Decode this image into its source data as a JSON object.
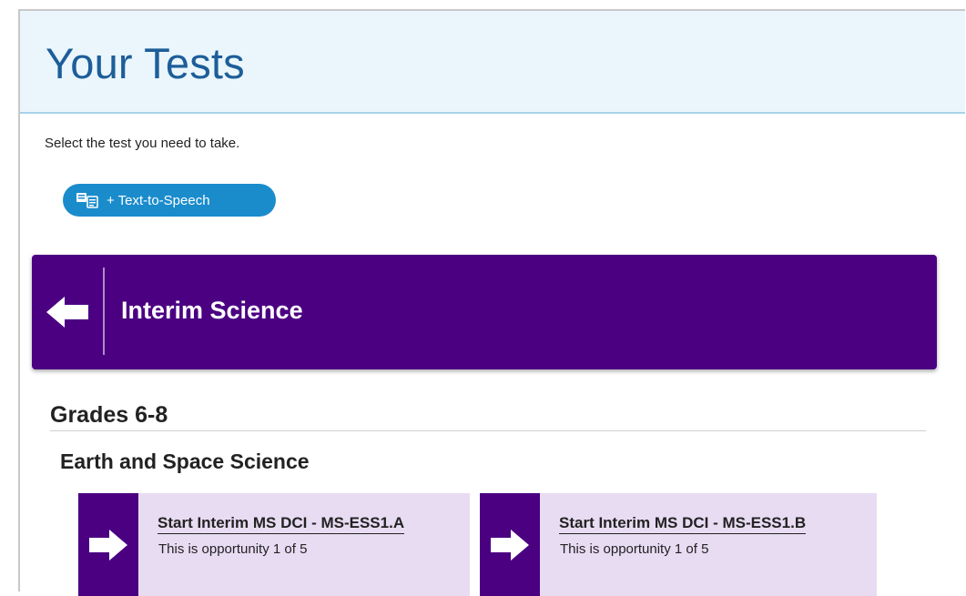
{
  "header": {
    "title": "Your Tests"
  },
  "instructions": "Select the test you need to take.",
  "tts_button": {
    "label": "+ Text-to-Speech",
    "icon": "text-to-speech-icon"
  },
  "subject": {
    "title": "Interim Science",
    "back_icon": "arrow-left-icon"
  },
  "grade": {
    "heading": "Grades 6-8"
  },
  "category": {
    "heading": "Earth and Space Science"
  },
  "tests": [
    {
      "title": "Start Interim MS DCI - MS-ESS1.A",
      "opportunity": "This is opportunity 1 of 5",
      "icon": "arrow-right-icon"
    },
    {
      "title": "Start Interim MS DCI - MS-ESS1.B",
      "opportunity": "This is opportunity 1 of 5",
      "icon": "arrow-right-icon"
    }
  ],
  "colors": {
    "header_bg": "#eaf6fc",
    "title_blue": "#1d5e99",
    "tts_blue": "#1a8ccc",
    "purple": "#4b0082",
    "card_lavender": "#e8dcf3"
  }
}
